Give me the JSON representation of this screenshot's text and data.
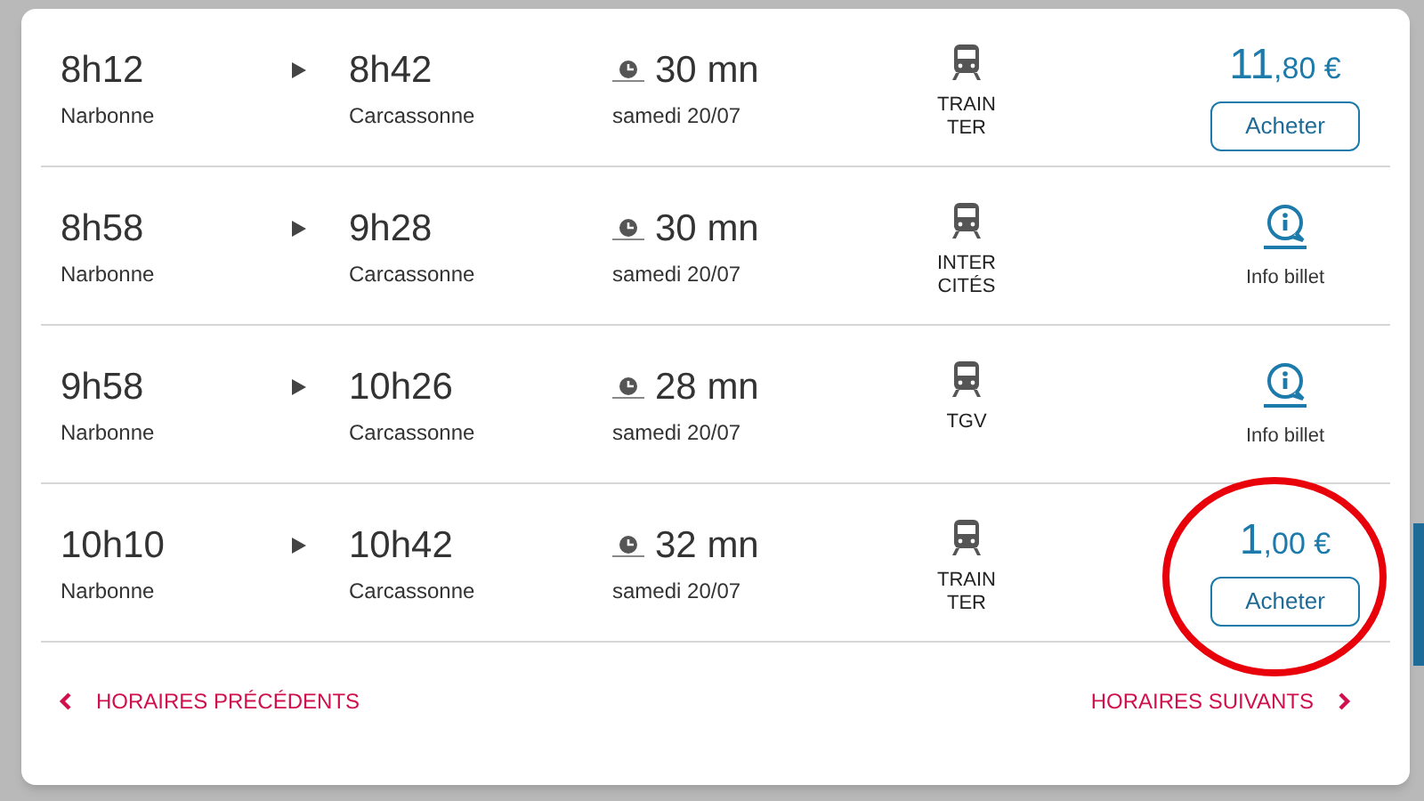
{
  "trips": [
    {
      "departure": "8h12",
      "from": "Narbonne",
      "arrival": "8h42",
      "to": "Carcassonne",
      "duration": "30 mn",
      "date": "samedi 20/07",
      "train": [
        "TRAIN",
        "TER"
      ],
      "offer": {
        "kind": "price",
        "price_main": "11",
        "price_cents": ",80 €",
        "button": "Acheter"
      },
      "highlighted": false
    },
    {
      "departure": "8h58",
      "from": "Narbonne",
      "arrival": "9h28",
      "to": "Carcassonne",
      "duration": "30 mn",
      "date": "samedi 20/07",
      "train": [
        "INTER",
        "CITÉS"
      ],
      "offer": {
        "kind": "info",
        "label": "Info billet"
      },
      "highlighted": false
    },
    {
      "departure": "9h58",
      "from": "Narbonne",
      "arrival": "10h26",
      "to": "Carcassonne",
      "duration": "28 mn",
      "date": "samedi 20/07",
      "train": [
        "TGV"
      ],
      "offer": {
        "kind": "info",
        "label": "Info billet"
      },
      "highlighted": false
    },
    {
      "departure": "10h10",
      "from": "Narbonne",
      "arrival": "10h42",
      "to": "Carcassonne",
      "duration": "32 mn",
      "date": "samedi 20/07",
      "train": [
        "TRAIN",
        "TER"
      ],
      "offer": {
        "kind": "price",
        "price_main": "1",
        "price_cents": ",00 €",
        "button": "Acheter"
      },
      "highlighted": true
    }
  ],
  "pager": {
    "previous": "HORAIRES PRÉCÉDENTS",
    "next": "HORAIRES SUIVANTS"
  }
}
